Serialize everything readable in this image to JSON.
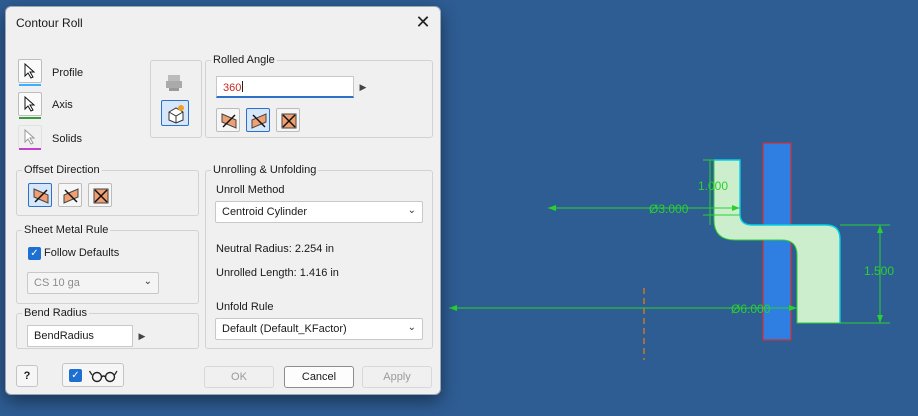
{
  "dialog": {
    "title": "Contour Roll",
    "close_glyph": "✕",
    "selectors": [
      {
        "label": "Profile",
        "underline": "#3ab0ff"
      },
      {
        "label": "Axis",
        "underline": "#3a9a3a"
      },
      {
        "label": "Solids",
        "underline": "#c13fcf"
      }
    ],
    "rolled_angle": {
      "title": "Rolled Angle",
      "value": "360"
    },
    "offset_direction": {
      "title": "Offset Direction"
    },
    "sheet_metal_rule": {
      "title": "Sheet Metal Rule",
      "follow_defaults_label": "Follow Defaults",
      "follow_defaults_checked": true,
      "rule_value": "CS 10 ga"
    },
    "bend_radius": {
      "title": "Bend Radius",
      "value": "BendRadius"
    },
    "unrolling": {
      "title": "Unrolling & Unfolding",
      "unroll_method_label": "Unroll Method",
      "unroll_method_value": "Centroid Cylinder",
      "neutral_radius": "Neutral Radius: 2.254 in",
      "unrolled_length": "Unrolled Length: 1.416 in",
      "unfold_rule_label": "Unfold Rule",
      "unfold_rule_value": "Default (Default_KFactor)"
    },
    "footer": {
      "ok_label": "OK",
      "cancel_label": "Cancel",
      "apply_label": "Apply",
      "help_glyph": "?",
      "preview_checked": true
    }
  },
  "viewport": {
    "background": "#2e5d94",
    "dimensions": {
      "d1": "1.000",
      "d2": "Ø3.000",
      "d3": "Ø6.000",
      "d4": "1.500"
    },
    "colors": {
      "dimension": "#29d12e",
      "profile_fill": "#cdeecd",
      "solid": "#2f7ee2",
      "solid_edge": "#d03030",
      "axis": "#c8742a",
      "arrow": "#e8403a"
    }
  }
}
